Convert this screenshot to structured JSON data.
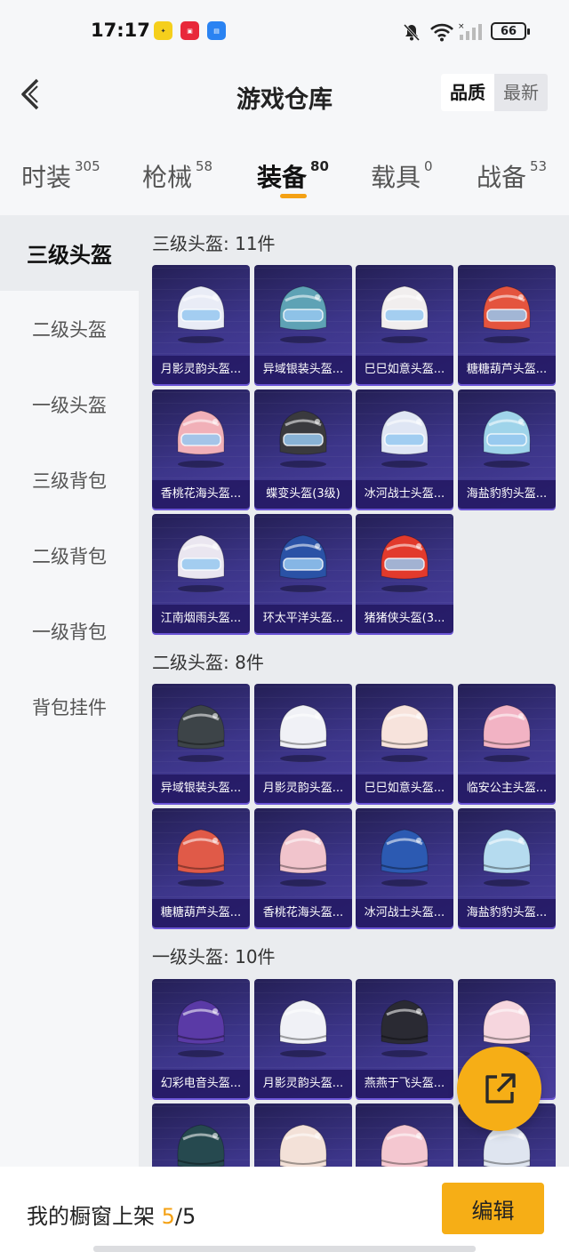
{
  "status_bar": {
    "time": "17:17",
    "battery": "66"
  },
  "header": {
    "title": "游戏仓库",
    "sort_options": [
      "品质",
      "最新"
    ]
  },
  "tabs": [
    {
      "label": "时装",
      "count": "305"
    },
    {
      "label": "枪械",
      "count": "58"
    },
    {
      "label": "装备",
      "count": "80"
    },
    {
      "label": "载具",
      "count": "0"
    },
    {
      "label": "战备",
      "count": "53"
    }
  ],
  "sidebar": [
    "三级头盔",
    "二级头盔",
    "一级头盔",
    "三级背包",
    "二级背包",
    "一级背包",
    "背包挂件"
  ],
  "groups": [
    {
      "title": "三级头盔: 11件",
      "items": [
        {
          "name": "月影灵韵头盔...",
          "color": "#e9ecf6"
        },
        {
          "name": "异域银装头盔...",
          "color": "#5ea2b5"
        },
        {
          "name": "巳巳如意头盔...",
          "color": "#f1eeee"
        },
        {
          "name": "糖糖葫芦头盔...",
          "color": "#e4543e"
        },
        {
          "name": "香桃花海头盔...",
          "color": "#f1b0b8"
        },
        {
          "name": "蝶变头盔(3级)",
          "color": "#3a3a3e"
        },
        {
          "name": "冰河战士头盔...",
          "color": "#dfe6f4"
        },
        {
          "name": "海盐豹豹头盔...",
          "color": "#9fd4ea"
        },
        {
          "name": "江南烟雨头盔...",
          "color": "#eae6f0"
        },
        {
          "name": "环太平洋头盔...",
          "color": "#2a52a6"
        },
        {
          "name": "猪猪侠头盔(3...",
          "color": "#e23a2c"
        }
      ]
    },
    {
      "title": "二级头盔: 8件",
      "items": [
        {
          "name": "异域银装头盔...",
          "color": "#3d4448"
        },
        {
          "name": "月影灵韵头盔...",
          "color": "#f0f1f6"
        },
        {
          "name": "巳巳如意头盔...",
          "color": "#f7e3dc"
        },
        {
          "name": "临安公主头盔...",
          "color": "#f2b3c4"
        },
        {
          "name": "糖糖葫芦头盔...",
          "color": "#e05a48"
        },
        {
          "name": "香桃花海头盔...",
          "color": "#f1c4cc"
        },
        {
          "name": "冰河战士头盔...",
          "color": "#2c5ab2"
        },
        {
          "name": "海盐豹豹头盔...",
          "color": "#b5dbef"
        }
      ]
    },
    {
      "title": "一级头盔: 10件",
      "items": [
        {
          "name": "幻彩电音头盔...",
          "color": "#5a3aa6"
        },
        {
          "name": "月影灵韵头盔...",
          "color": "#f0f1f6"
        },
        {
          "name": "燕燕于飞头盔...",
          "color": "#2a2a33"
        },
        {
          "name": "",
          "color": "#f6d6de"
        },
        {
          "name": "",
          "color": "#26494f"
        },
        {
          "name": "",
          "color": "#f3e1d8"
        },
        {
          "name": "",
          "color": "#f4c7d0"
        },
        {
          "name": "",
          "color": "#dfe5f0"
        }
      ]
    }
  ],
  "footer": {
    "label": "我的橱窗上架",
    "current": "5",
    "separator": "/",
    "total": "5",
    "edit": "编辑"
  }
}
